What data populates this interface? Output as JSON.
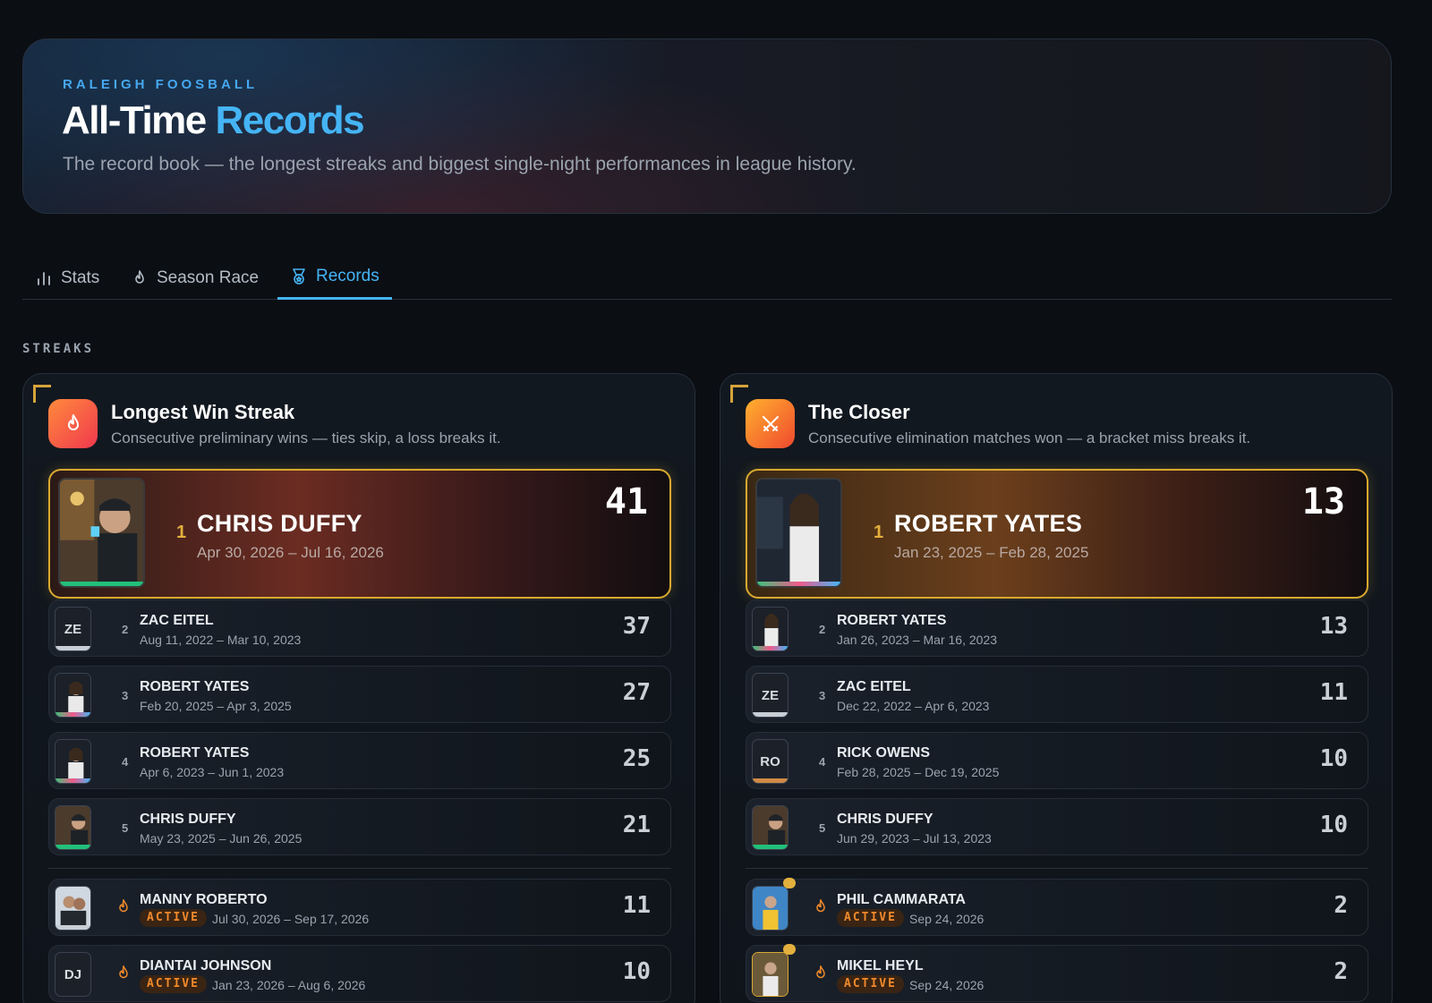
{
  "header": {
    "eyebrow": "RALEIGH FOOSBALL",
    "title_main": "All-Time",
    "title_accent": "Records",
    "subtitle": "The record book — the longest streaks and biggest single-night performances in league history."
  },
  "tabs": [
    {
      "label": "Stats",
      "icon": "bar-chart-icon",
      "active": false
    },
    {
      "label": "Season Race",
      "icon": "flame-icon",
      "active": false
    },
    {
      "label": "Records",
      "icon": "medal-icon",
      "active": true
    }
  ],
  "section_label": "STREAKS",
  "cards": [
    {
      "title": "Longest Win Streak",
      "description": "Consecutive preliminary wins — ties skip, a loss breaks it.",
      "icon": "flame-icon",
      "top": {
        "rank": "1",
        "name": "CHRIS DUFFY",
        "dates": "Apr 30, 2026 – Jul 16, 2026",
        "value": "41"
      },
      "rows": [
        {
          "rank": "2",
          "name": "ZAC EITEL",
          "dates": "Aug 11, 2022 – Mar 10, 2023",
          "value": "37",
          "initials": "ZE"
        },
        {
          "rank": "3",
          "name": "ROBERT YATES",
          "dates": "Feb 20, 2025 – Apr 3, 2025",
          "value": "27",
          "initials": ""
        },
        {
          "rank": "4",
          "name": "ROBERT YATES",
          "dates": "Apr 6, 2023 – Jun 1, 2023",
          "value": "25",
          "initials": ""
        },
        {
          "rank": "5",
          "name": "CHRIS DUFFY",
          "dates": "May 23, 2025 – Jun 26, 2025",
          "value": "21",
          "initials": ""
        }
      ],
      "active": [
        {
          "name": "MANNY ROBERTO",
          "badge": "ACTIVE",
          "dates": "Jul 30, 2026 – Sep 17, 2026",
          "value": "11",
          "initials": ""
        },
        {
          "name": "DIANTAI JOHNSON",
          "badge": "ACTIVE",
          "dates": "Jan 23, 2026 – Aug 6, 2026",
          "value": "10",
          "initials": "DJ"
        }
      ]
    },
    {
      "title": "The Closer",
      "description": "Consecutive elimination matches won — a bracket miss breaks it.",
      "icon": "crossed-swords-icon",
      "top": {
        "rank": "1",
        "name": "ROBERT YATES",
        "dates": "Jan 23, 2025 – Feb 28, 2025",
        "value": "13"
      },
      "rows": [
        {
          "rank": "2",
          "name": "ROBERT YATES",
          "dates": "Jan 26, 2023 – Mar 16, 2023",
          "value": "13",
          "initials": ""
        },
        {
          "rank": "3",
          "name": "ZAC EITEL",
          "dates": "Dec 22, 2022 – Apr 6, 2023",
          "value": "11",
          "initials": "ZE"
        },
        {
          "rank": "4",
          "name": "RICK OWENS",
          "dates": "Feb 28, 2025 – Dec 19, 2025",
          "value": "10",
          "initials": "RO"
        },
        {
          "rank": "5",
          "name": "CHRIS DUFFY",
          "dates": "Jun 29, 2023 – Jul 13, 2023",
          "value": "10",
          "initials": ""
        }
      ],
      "active": [
        {
          "name": "PHIL CAMMARATA",
          "badge": "ACTIVE",
          "dates": "Sep 24, 2026",
          "value": "2",
          "initials": ""
        },
        {
          "name": "MIKEL HEYL",
          "badge": "ACTIVE",
          "dates": "Sep 24, 2026",
          "value": "2",
          "initials": ""
        }
      ]
    }
  ],
  "colors": {
    "accent": "#45b4f5",
    "gold": "#d9a92f",
    "active": "#f08a2c",
    "background": "#0b0e13"
  }
}
